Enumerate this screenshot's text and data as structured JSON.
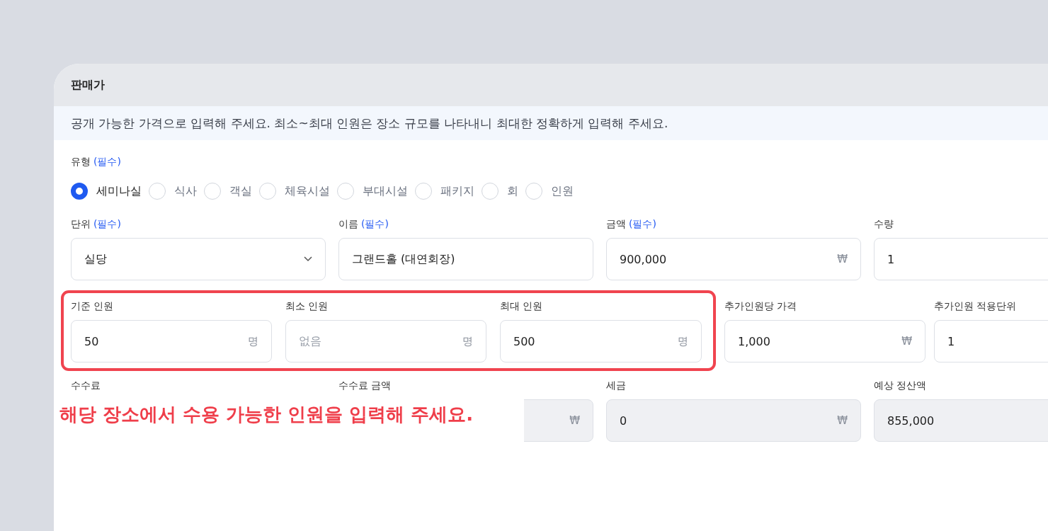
{
  "section": {
    "title": "판매가",
    "notice": "공개 가능한 가격으로 입력해 주세요. 최소~최대 인원은 장소 규모를 나타내니 최대한 정확하게 입력해 주세요."
  },
  "type_field": {
    "label": "유형",
    "required_mark": "(필수)",
    "options": [
      {
        "label": "세미나실",
        "selected": true
      },
      {
        "label": "식사",
        "selected": false
      },
      {
        "label": "객실",
        "selected": false
      },
      {
        "label": "체육시설",
        "selected": false
      },
      {
        "label": "부대시설",
        "selected": false
      },
      {
        "label": "패키지",
        "selected": false
      },
      {
        "label": "회",
        "selected": false
      },
      {
        "label": "인원",
        "selected": false
      }
    ]
  },
  "row_1": [
    {
      "label": "단위",
      "required_mark": "(필수)",
      "kind": "select",
      "value": "실당",
      "disabled": false
    },
    {
      "label": "이름",
      "required_mark": "(필수)",
      "kind": "input",
      "value": "그랜드홀 (대연회장)",
      "disabled": false
    },
    {
      "label": "금액",
      "required_mark": "(필수)",
      "kind": "input",
      "value": "900,000",
      "unit": "₩",
      "disabled": false
    },
    {
      "label": "수량",
      "kind": "input",
      "value": "1",
      "disabled": false
    }
  ],
  "row_2": {
    "highlighted": [
      {
        "label": "기준 인원",
        "kind": "input",
        "value": "50",
        "unit": "명",
        "disabled": false
      },
      {
        "label": "최소 인원",
        "kind": "input",
        "placeholder": "없음",
        "unit": "명",
        "disabled": false
      },
      {
        "label": "최대 인원",
        "kind": "input",
        "value": "500",
        "unit": "명",
        "disabled": false
      }
    ],
    "others": [
      {
        "label": "추가인원당 가격",
        "kind": "input",
        "value": "1,000",
        "unit": "₩",
        "disabled": false
      },
      {
        "label": "추가인원 적용단위",
        "kind": "input",
        "value": "1",
        "disabled": false
      }
    ]
  },
  "row_3": [
    {
      "label": "수수료"
    },
    {
      "label": "수수료 금액",
      "kind": "input",
      "unit": "₩",
      "disabled": true
    },
    {
      "label": "세금",
      "kind": "input",
      "value": "0",
      "unit": "₩",
      "disabled": true
    },
    {
      "label": "예상 정산액",
      "kind": "input",
      "value": "855,000",
      "disabled": true
    }
  ],
  "annotation": {
    "text": "해당 장소에서 수용 가능한 인원을 입력해 주세요."
  }
}
